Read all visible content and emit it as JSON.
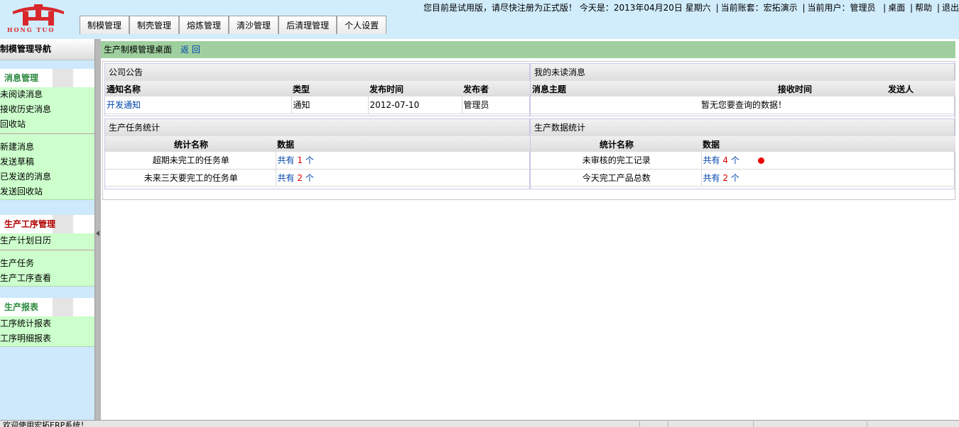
{
  "header": {
    "logo_alt": "HONG TUO",
    "info": "您目前是试用版，请尽快注册为正式版！ 今天是：2013年04月20日 星期六",
    "account": "当前账套：宏拓演示",
    "user": "当前用户：管理员",
    "links": [
      "桌面",
      "帮助",
      "退出"
    ],
    "menu": [
      "制模管理",
      "制壳管理",
      "熔炼管理",
      "清沙管理",
      "后清理管理",
      "个人设置"
    ]
  },
  "sidebar": {
    "title": "制模管理导航",
    "groups": [
      {
        "head": "消息管理",
        "items": [
          "未阅读消息",
          "接收历史消息",
          "回收站"
        ],
        "items2": [
          "新建消息",
          "发送草稿",
          "已发送的消息",
          "发送回收站"
        ]
      },
      {
        "head": "生产工序管理",
        "items": [
          "生产计划日历"
        ],
        "items2": [
          "生产任务",
          "生产工序查看"
        ]
      },
      {
        "head": "生产报表",
        "items": [
          "工序统计报表",
          "工序明细报表"
        ]
      }
    ]
  },
  "main": {
    "crumb": "生产制模管理桌面",
    "back": "返 回",
    "notice": {
      "title": "公司公告",
      "cols": [
        "通知名称",
        "类型",
        "发布时间",
        "发布者"
      ],
      "rows": [
        [
          "开发通知",
          "通知",
          "2012-07-10",
          "管理员"
        ]
      ]
    },
    "unread": {
      "title": "我的未读消息",
      "cols": [
        "消息主题",
        "接收时间",
        "发送人"
      ],
      "empty": "暂无您要查询的数据！"
    },
    "task_stats": {
      "title": "生产任务统计",
      "cols": [
        "统计名称",
        "数据"
      ],
      "rows": [
        {
          "name": "超期未完工的任务单",
          "pre": "共有",
          "num": "1",
          "unit": "个"
        },
        {
          "name": "未来三天要完工的任务单",
          "pre": "共有",
          "num": "2",
          "unit": "个"
        }
      ]
    },
    "data_stats": {
      "title": "生产数据统计",
      "cols": [
        "统计名称",
        "数据"
      ],
      "rows": [
        {
          "name": "未审核的完工记录",
          "pre": "共有",
          "num": "4",
          "unit": "个"
        },
        {
          "name": "今天完工产品总数",
          "pre": "共有",
          "num": "2",
          "unit": "个"
        }
      ]
    }
  },
  "status": {
    "text": "欢迎使用宏拓ERP系统！"
  },
  "colors": {
    "header_bg": "#d1ecfb",
    "sidebar_bg": "#cde9fb",
    "group_body": "#ccffcc",
    "crumb_bg": "#9fcf9f",
    "link": "#0044aa",
    "alert": "#dd0000"
  }
}
